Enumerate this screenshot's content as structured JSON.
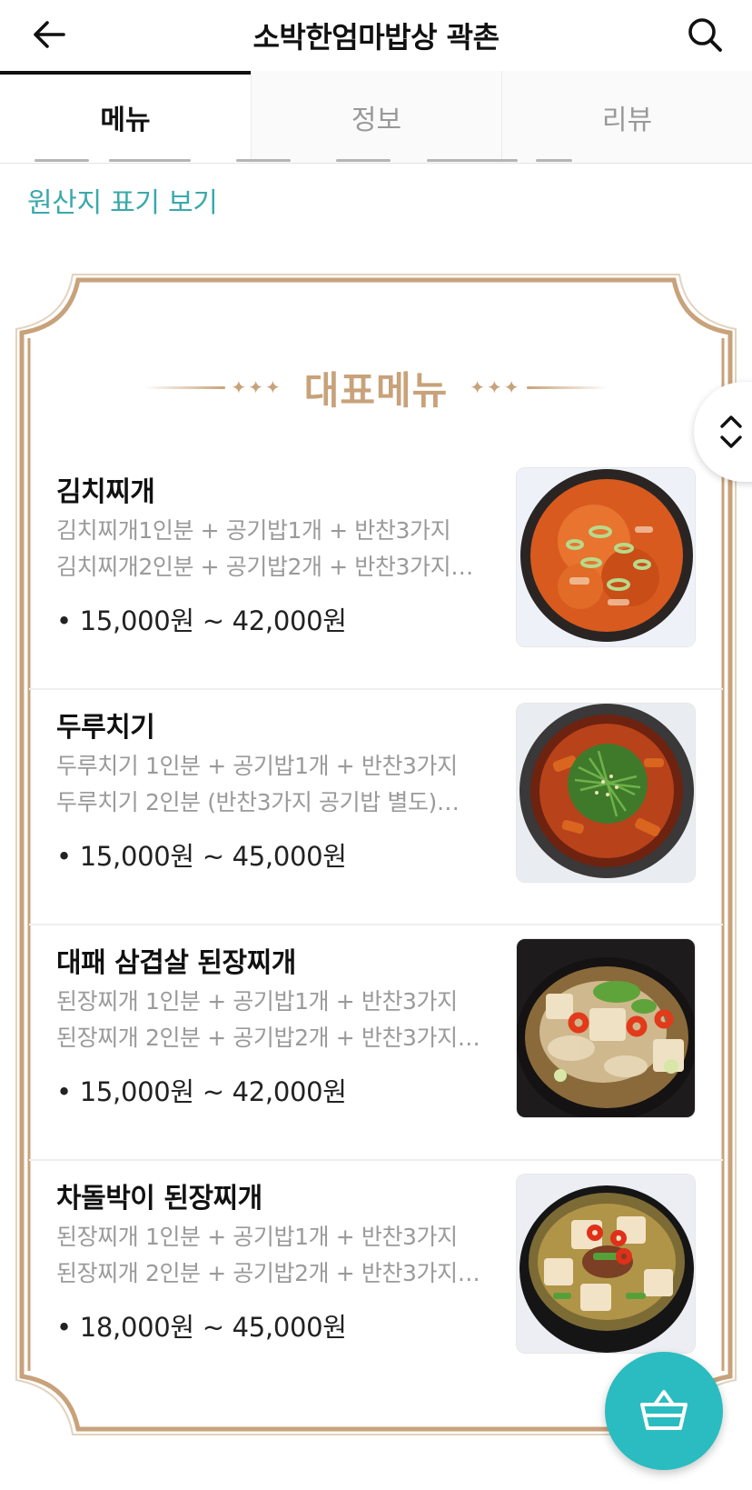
{
  "header": {
    "title": "소박한엄마밥상 곽촌",
    "back_icon": "arrow-left-icon",
    "search_icon": "search-icon"
  },
  "tabs": [
    {
      "label": "메뉴",
      "active": true
    },
    {
      "label": "정보",
      "active": false
    },
    {
      "label": "리뷰",
      "active": false
    }
  ],
  "origin_link": "원산지 표기 보기",
  "section": {
    "title": "대표메뉴",
    "accent_color": "#c8a27a"
  },
  "menu_items": [
    {
      "name": "김치찌개",
      "desc_line1": "김치찌개1인분 + 공기밥1개 + 반찬3가지",
      "desc_line2": "김치찌개2인분 + 공기밥2개 + 반찬3가지…",
      "price": "• 15,000원 ~ 42,000원",
      "photo": "kimchi-stew"
    },
    {
      "name": "두루치기",
      "desc_line1": "두루치기 1인분 + 공기밥1개 + 반찬3가지",
      "desc_line2": "두루치기 2인분 (반찬3가지 공기밥 별도)…",
      "price": "• 15,000원 ~ 45,000원",
      "photo": "duruchigi"
    },
    {
      "name": "대패 삼겹살 된장찌개",
      "desc_line1": "된장찌개 1인분 + 공기밥1개 + 반찬3가지",
      "desc_line2": "된장찌개 2인분 + 공기밥2개 + 반찬3가지…",
      "price": "• 15,000원 ~ 42,000원",
      "photo": "doenjang-pork"
    },
    {
      "name": "차돌박이 된장찌개",
      "desc_line1": "된장찌개 1인분 + 공기밥1개 + 반찬3가지",
      "desc_line2": "된장찌개 2인분 + 공기밥2개 + 반찬3가지…",
      "price": "• 18,000원 ~ 45,000원",
      "photo": "doenjang-brisket"
    }
  ],
  "colors": {
    "brand": "#2abcc0",
    "link": "#3aa9ab",
    "frame": "#c8a27a"
  },
  "floating": {
    "scroll_toggle_icon": "chevron-up-down-icon",
    "cart_icon": "basket-icon"
  }
}
